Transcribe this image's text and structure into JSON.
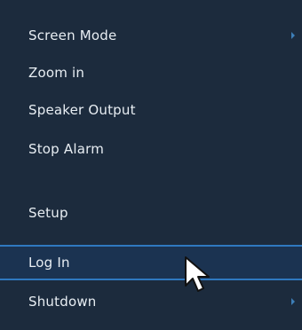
{
  "menu": {
    "items": [
      {
        "label": "Screen Mode",
        "icon": "chevron-right-icon"
      },
      {
        "label": "Zoom in"
      },
      {
        "label": "Speaker Output"
      },
      {
        "label": "Stop Alarm"
      },
      {
        "label": "Setup"
      },
      {
        "label": "Log In"
      },
      {
        "label": "Shutdown",
        "icon": "chevron-right-icon"
      }
    ],
    "selected_label": "Log In"
  },
  "colors": {
    "background": "#1c2b3d",
    "selection_background": "#1b3351",
    "selection_border": "#2f79c0",
    "text": "#e8eef3",
    "arrow": "#3d7fb8"
  },
  "cursor": {
    "icon": "mouse-pointer-icon"
  }
}
